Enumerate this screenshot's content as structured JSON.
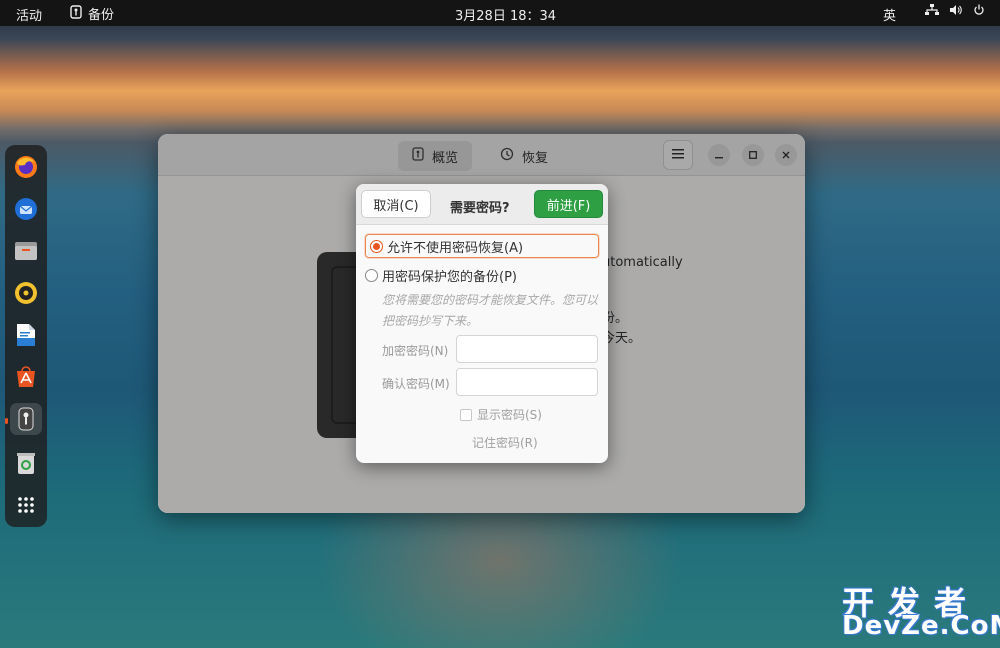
{
  "topbar": {
    "activities": "活动",
    "app_name": "备份",
    "clock": "3月28日  18：34",
    "input_method": "英"
  },
  "dock": {
    "items": [
      "firefox-icon",
      "thunderbird-icon",
      "files-icon",
      "rhythmbox-icon",
      "writer-icon",
      "software-icon",
      "backup-icon",
      "trash-icon",
      "app-grid-icon"
    ]
  },
  "window": {
    "tabs": [
      {
        "label": "概览",
        "icon": "overview-icon"
      },
      {
        "label": "恢复",
        "icon": "history-icon"
      }
    ],
    "background_text": {
      "line1": "utomatically",
      "line2": "份。",
      "line3": "今天。"
    }
  },
  "dialog": {
    "cancel": "取消(C)",
    "title": "需要密码?",
    "forward": "前进(F)",
    "option_no_password": "允许不使用密码恢复(A)",
    "option_password": "用密码保护您的备份(P)",
    "hint": "您将需要您的密码才能恢复文件。您可以把密码抄写下来。",
    "encrypt_label": "加密密码(N)",
    "confirm_label": "确认密码(M)",
    "show_password": "显示密码(S)",
    "remember_password": "记住密码(R)"
  },
  "watermark": {
    "line1": "开发者",
    "line2": "DevZe.CoM"
  },
  "colors": {
    "accent": "#e95420",
    "forward_button": "#2ea043"
  }
}
